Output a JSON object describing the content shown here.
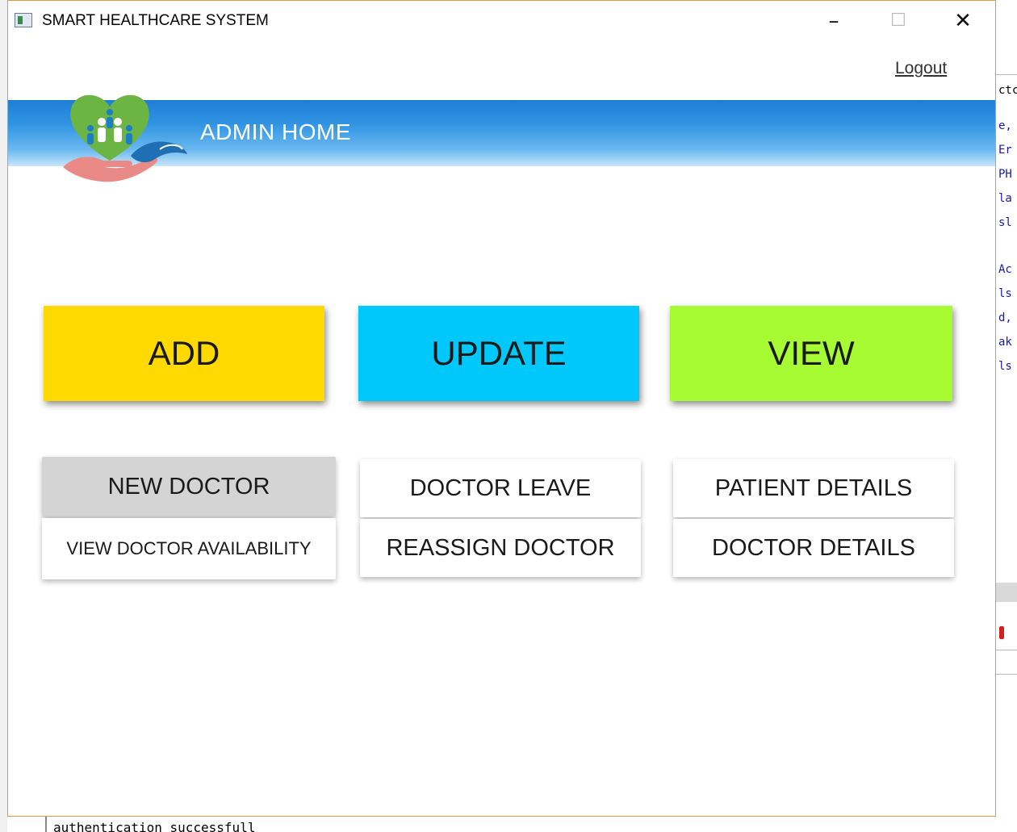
{
  "window": {
    "title": "SMART HEALTHCARE SYSTEM",
    "minimize_icon": "–",
    "maximize_icon": "☐",
    "close_icon": "✕"
  },
  "header": {
    "logout_label": "Logout",
    "banner_title": "ADMIN HOME",
    "logo_icon": "healthcare-hands-heart-logo"
  },
  "main_actions": {
    "add_label": "ADD",
    "update_label": "UPDATE",
    "view_label": "VIEW"
  },
  "add_options": {
    "new_doctor_label": "NEW DOCTOR",
    "view_availability_label": "VIEW DOCTOR AVAILABILITY"
  },
  "update_options": {
    "doctor_leave_label": "DOCTOR LEAVE",
    "reassign_doctor_label": "REASSIGN DOCTOR"
  },
  "view_options": {
    "patient_details_label": "PATIENT DETAILS",
    "doctor_details_label": "DOCTOR DETAILS"
  },
  "background": {
    "editor_fragments": [
      "ctc",
      "e,",
      "Er",
      "PH",
      "la",
      "sl",
      "Ac",
      "ls",
      "d,",
      "ak",
      "ls"
    ],
    "console_text": "authentication successfull"
  },
  "colors": {
    "add": "#ffd900",
    "update": "#00c8fb",
    "view": "#a6fb32",
    "banner": "#2f93e2",
    "selected_option": "#d4d4d4"
  }
}
